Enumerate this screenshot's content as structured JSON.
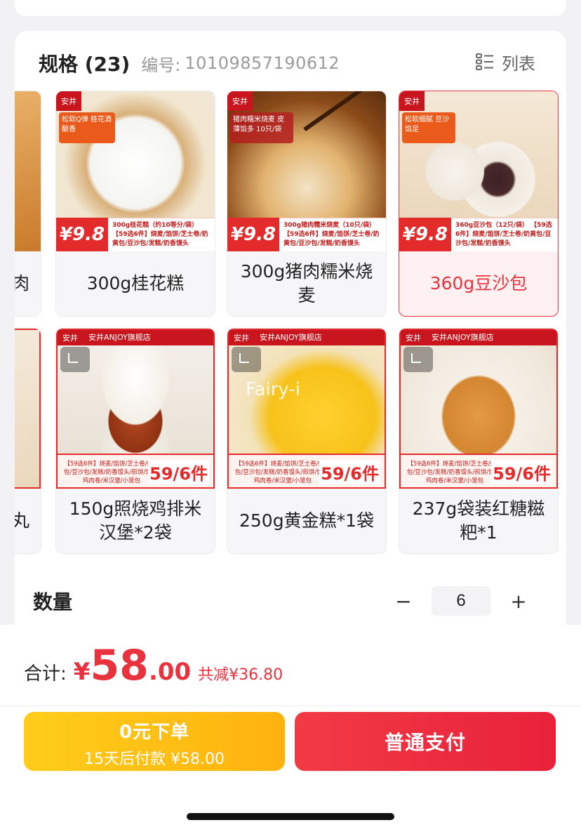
{
  "spec": {
    "title": "规格 (23)",
    "code_label": "编号:",
    "code": "10109857190612",
    "list_toggle_label": "列表"
  },
  "products": [
    {
      "name": "肉",
      "partial": true
    },
    {
      "name": "300g桂花糕",
      "promo_price": "¥9.8",
      "badge": "松软Q弹 桂花酒酿香",
      "promo_text": "300g桂花糕（约10等分/袋） 【59选6件】烧麦/馅饼/芝士卷/奶黄包/豆沙包/发糕/奶香馒头"
    },
    {
      "name": "300g猪肉糯米烧麦",
      "promo_price": "¥9.8",
      "badge": "猪肉糯米烧麦 皮薄馅多 10只/袋",
      "promo_text": "300g猪肉糯米烧麦（10只/袋） 【59选6件】烧麦/馅饼/芝士卷/奶黄包/豆沙包/发糕/奶香馒头"
    },
    {
      "name": "360g豆沙包",
      "promo_price": "¥9.8",
      "badge": "松软细腻 豆沙馅足",
      "promo_text": "360g豆沙包（12只/袋） 【59选6件】烧麦/馅饼/芝士卷/奶黄包/豆沙包/发糕/奶香馒头",
      "selected": true
    },
    {
      "name": "丸",
      "partial": true
    },
    {
      "name": "150g照烧鸡排米汉堡*2袋",
      "store": "安井ANJOY旗舰店",
      "price": "59/6件",
      "promo_text": "【59选6件】烧麦/馅饼/芝士卷/奶黄包/豆沙包/发糕/奶香馒头/煎饼/馅饼/鸡肉卷/米汉堡/小笼包"
    },
    {
      "name": "250g黄金糕*1袋",
      "store": "安井ANJOY旗舰店",
      "price": "59/6件",
      "promo_text": "【59选6件】烧麦/馅饼/芝士卷/奶黄包/豆沙包/发糕/奶香馒头/煎饼/馅饼/鸡肉卷/米汉堡/小笼包",
      "watermark": "Fairy-i"
    },
    {
      "name": "237g袋装红糖糍粑*1",
      "store": "安井ANJOY旗舰店",
      "price": "59/6件",
      "promo_text": "【59选6件】烧麦/馅饼/芝士卷/奶黄包/豆沙包/发糕/奶香馒头/煎饼/馅饼/鸡肉卷/米汉堡/小笼包"
    }
  ],
  "quantity": {
    "label": "数量",
    "value": "6",
    "minus": "−",
    "plus": "+"
  },
  "total": {
    "label": "合计:",
    "currency": "¥",
    "integer": "58",
    "decimal": ".00",
    "discount": "共减¥36.80"
  },
  "buttons": {
    "later_line1": "0元下单",
    "later_line2": "15天后付款 ¥58.00",
    "pay": "普通支付"
  },
  "colors": {
    "accent": "#e8333f",
    "later_button": "#ffbf12",
    "pay_button": "#ee2c40"
  }
}
